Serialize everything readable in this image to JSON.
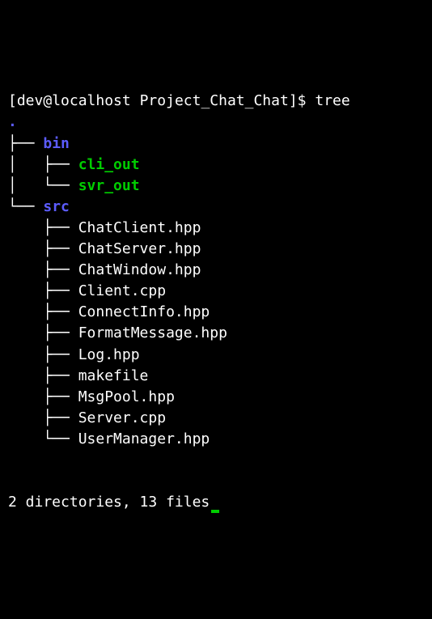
{
  "prompt": {
    "user": "dev",
    "host": "localhost",
    "cwd": "Project_Chat_Chat",
    "symbol": "$",
    "command": "tree"
  },
  "tree": {
    "root": ".",
    "branches": {
      "tee": "├── ",
      "elbow": "└── ",
      "pipe": "│   ",
      "space": "    "
    },
    "children": [
      {
        "name": "bin",
        "type": "dir",
        "children": [
          {
            "name": "cli_out",
            "type": "exec"
          },
          {
            "name": "svr_out",
            "type": "exec"
          }
        ]
      },
      {
        "name": "src",
        "type": "dir",
        "children": [
          {
            "name": "ChatClient.hpp",
            "type": "file"
          },
          {
            "name": "ChatServer.hpp",
            "type": "file"
          },
          {
            "name": "ChatWindow.hpp",
            "type": "file"
          },
          {
            "name": "Client.cpp",
            "type": "file"
          },
          {
            "name": "ConnectInfo.hpp",
            "type": "file"
          },
          {
            "name": "FormatMessage.hpp",
            "type": "file"
          },
          {
            "name": "Log.hpp",
            "type": "file"
          },
          {
            "name": "makefile",
            "type": "file"
          },
          {
            "name": "MsgPool.hpp",
            "type": "file"
          },
          {
            "name": "Server.cpp",
            "type": "file"
          },
          {
            "name": "UserManager.hpp",
            "type": "file"
          }
        ]
      }
    ]
  },
  "summary": "2 directories, 13 files"
}
